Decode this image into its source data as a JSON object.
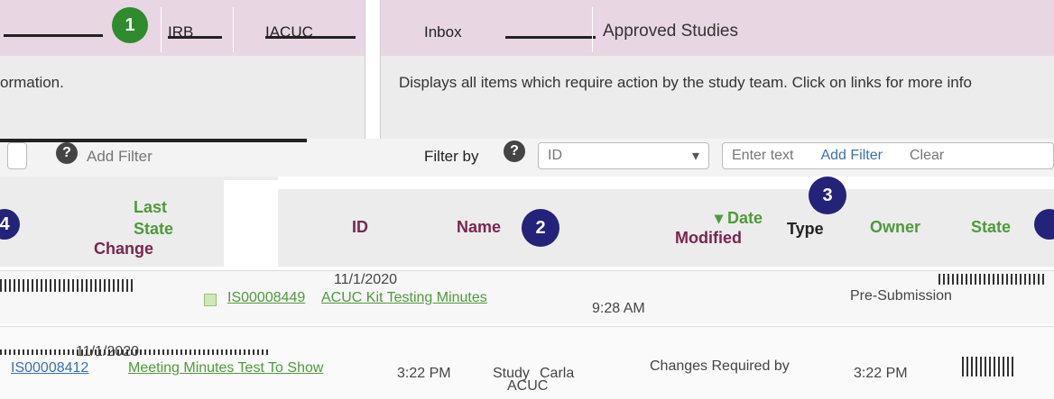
{
  "nav": {
    "tabs": [
      "IRB",
      "IACUC",
      "Inbox"
    ],
    "approved_label": "Approved Studies",
    "badge_1": "1"
  },
  "info": {
    "left_text": "ormation.",
    "right_text": "Displays all items which require action by the study team. Click on links for more info"
  },
  "filters": {
    "left_label": "Add Filter",
    "right_label": "Filter by",
    "select_value": "ID",
    "text_placeholder": "Enter text",
    "add_filter": "Add Filter",
    "clear": "Clear",
    "help": "?"
  },
  "badges": {
    "two": "2",
    "three": "3",
    "four": "4"
  },
  "table": {
    "headers": {
      "last_state_change_1": "Last",
      "last_state_change_2": "State",
      "last_state_change_3": "Change",
      "id": "ID",
      "name": "Name",
      "date_modified_1": "Date",
      "date_modified_2": "Modified",
      "type": "Type",
      "owner": "Owner",
      "state": "State"
    },
    "rows": [
      {
        "id": "IS00008449",
        "name": "ACUC Kit Testing Minutes",
        "date": "11/1/2020",
        "time": "9:28 AM",
        "state": "Pre-Submission"
      },
      {
        "id": "IS00008412",
        "name": "Meeting Minutes Test To Show",
        "date": "11/1/2020",
        "time": "3:22 PM",
        "type": "Study",
        "owner": "Carla",
        "committee": "ACUC",
        "state": "Changes Required by",
        "time_right": "3:22 PM"
      }
    ]
  }
}
